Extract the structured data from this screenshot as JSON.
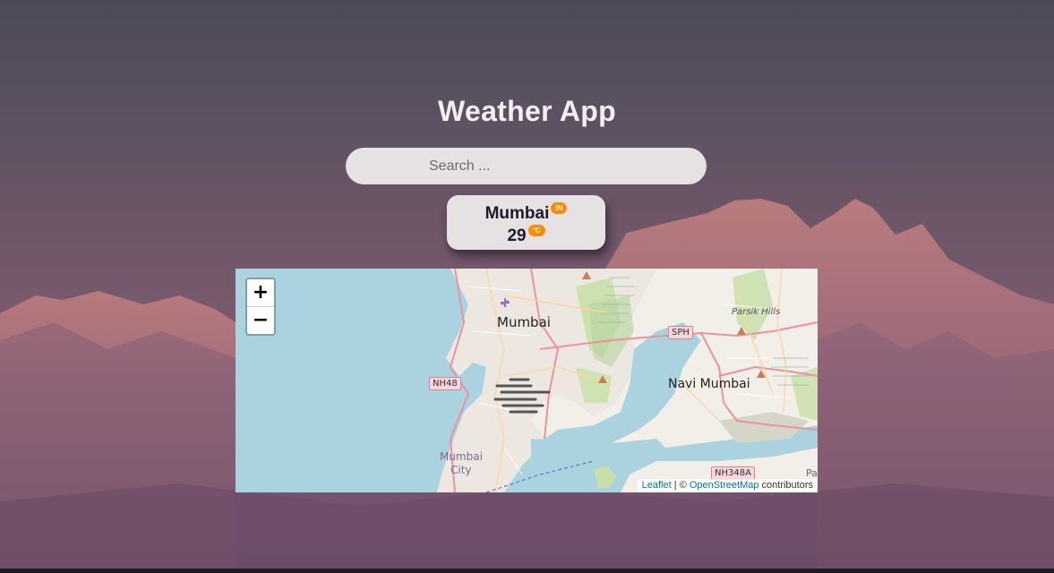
{
  "app": {
    "title": "Weather App"
  },
  "search": {
    "placeholder": "Search ..."
  },
  "weather": {
    "city": "Mumbai",
    "country_code": "IN",
    "temperature": "29",
    "unit": "°C",
    "accent_color": "#ff8a00"
  },
  "map": {
    "zoom_in_label": "+",
    "zoom_out_label": "−",
    "labels": {
      "mumbai": "Mumbai",
      "navi_mumbai": "Navi Mumbai",
      "mumbai_city_1": "Mumbai",
      "mumbai_city_2": "City",
      "parsik_hills": "Parsik Hills",
      "edge_text": "Par"
    },
    "shields": {
      "nh48": "NH48",
      "sph": "SPH",
      "nh348a": "NH348A"
    },
    "attribution": {
      "leaflet": "Leaflet",
      "separator": " | © ",
      "osm": "OpenStreetMap",
      "contributors": " contributors"
    },
    "colors": {
      "water": "#aad3df",
      "land": "#f2efe9"
    }
  }
}
